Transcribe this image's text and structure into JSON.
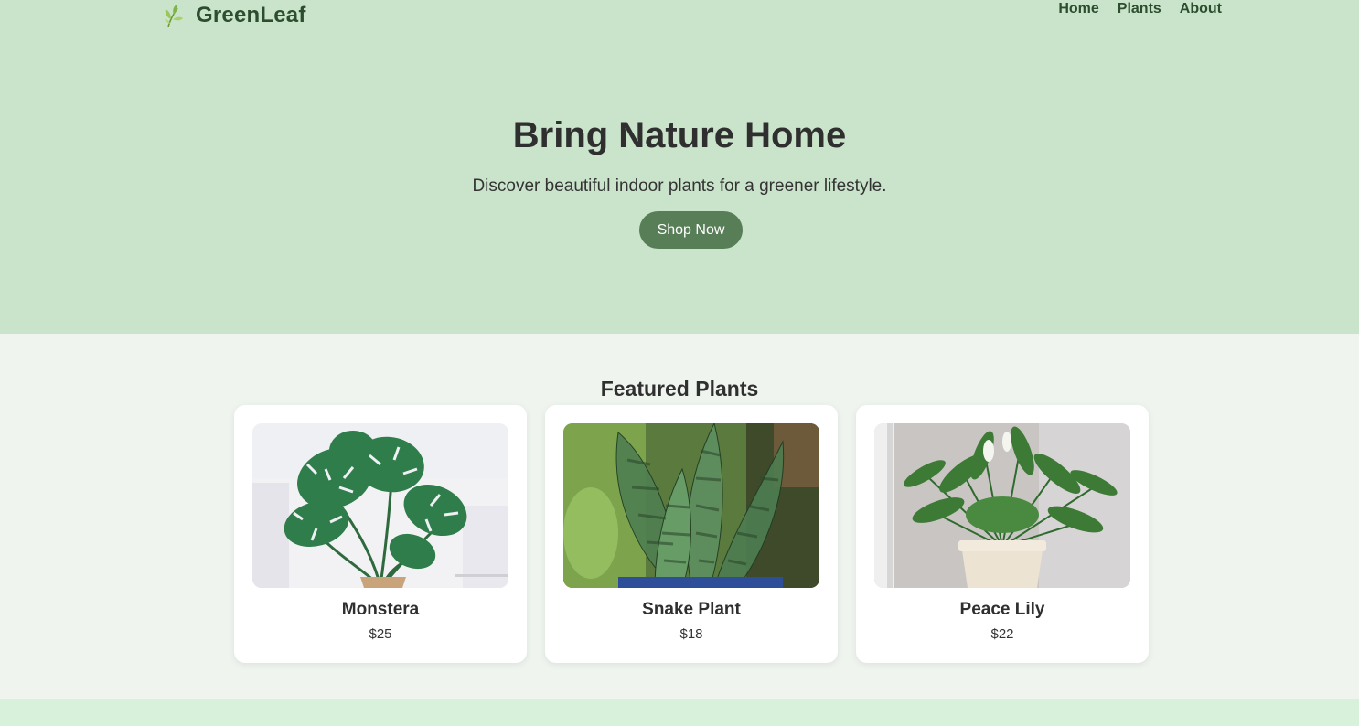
{
  "brand": {
    "name": "GreenLeaf",
    "icon": "leaf-icon"
  },
  "nav": {
    "items": [
      "Home",
      "Plants",
      "About"
    ]
  },
  "hero": {
    "title": "Bring Nature Home",
    "subtitle": "Discover beautiful indoor plants for a greener lifestyle.",
    "cta_label": "Shop Now"
  },
  "featured": {
    "title": "Featured Plants",
    "products": [
      {
        "name": "Monstera",
        "price": "$25"
      },
      {
        "name": "Snake Plant",
        "price": "$18"
      },
      {
        "name": "Peace Lily",
        "price": "$22"
      }
    ]
  },
  "colors": {
    "hero_bg": "#cae4cb",
    "page_bg": "#eff4ef",
    "accent": "#587e58",
    "brand_text": "#2c4e2e",
    "footer_bg": "#d8f1da"
  }
}
